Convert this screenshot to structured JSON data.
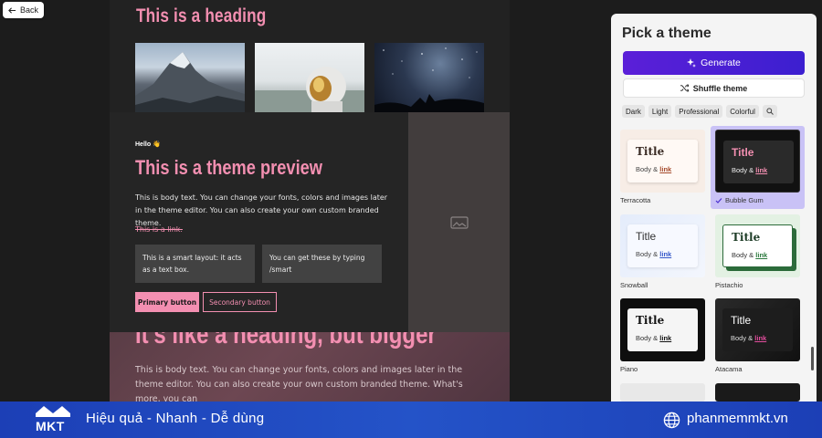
{
  "back": {
    "label": "Back"
  },
  "preview": {
    "heading": "This is a heading",
    "hello": "Hello 👋",
    "theme_title": "This is a theme preview",
    "body_text": "This is body text. You can change your fonts, colors and images later in the theme editor. You can also create your own custom branded theme.",
    "link_text": "This is a link.",
    "smart_box_1": "This is a smart layout: it acts as a text box.",
    "smart_box_2": "You can get these by typing /smart",
    "primary_button": "Primary button",
    "secondary_button": "Secondary button",
    "bigger_heading": "It's like a heading, but bigger",
    "lower_body": "This is body text. You can change your fonts, colors and images later in the theme editor. You can also create your own custom branded theme. What's more, you can"
  },
  "panel": {
    "title": "Pick a theme",
    "generate": "Generate",
    "shuffle": "Shuffle theme",
    "filters": [
      "Dark",
      "Light",
      "Professional",
      "Colorful"
    ],
    "themes": [
      {
        "name": "Terracotta",
        "title": "Title",
        "body": "Body &",
        "link": "link",
        "selected": false
      },
      {
        "name": "Bubble Gum",
        "title": "Title",
        "body": "Body &",
        "link": "link",
        "selected": true
      },
      {
        "name": "Snowball",
        "title": "Title",
        "body": "Body &",
        "link": "link",
        "selected": false
      },
      {
        "name": "Pistachio",
        "title": "Title",
        "body": "Body &",
        "link": "link",
        "selected": false
      },
      {
        "name": "Piano",
        "title": "Title",
        "body": "Body &",
        "link": "link",
        "selected": false
      },
      {
        "name": "Atacama",
        "title": "Title",
        "body": "Body &",
        "link": "link",
        "selected": false
      }
    ]
  },
  "footer": {
    "logo": "MKT",
    "tagline": "Hiệu quả - Nhanh - Dễ dùng",
    "site": "phanmemmkt.vn"
  },
  "colors": {
    "accent": "#f38fb1",
    "generate": "#4b1fd5",
    "footer": "#1f47bf"
  }
}
